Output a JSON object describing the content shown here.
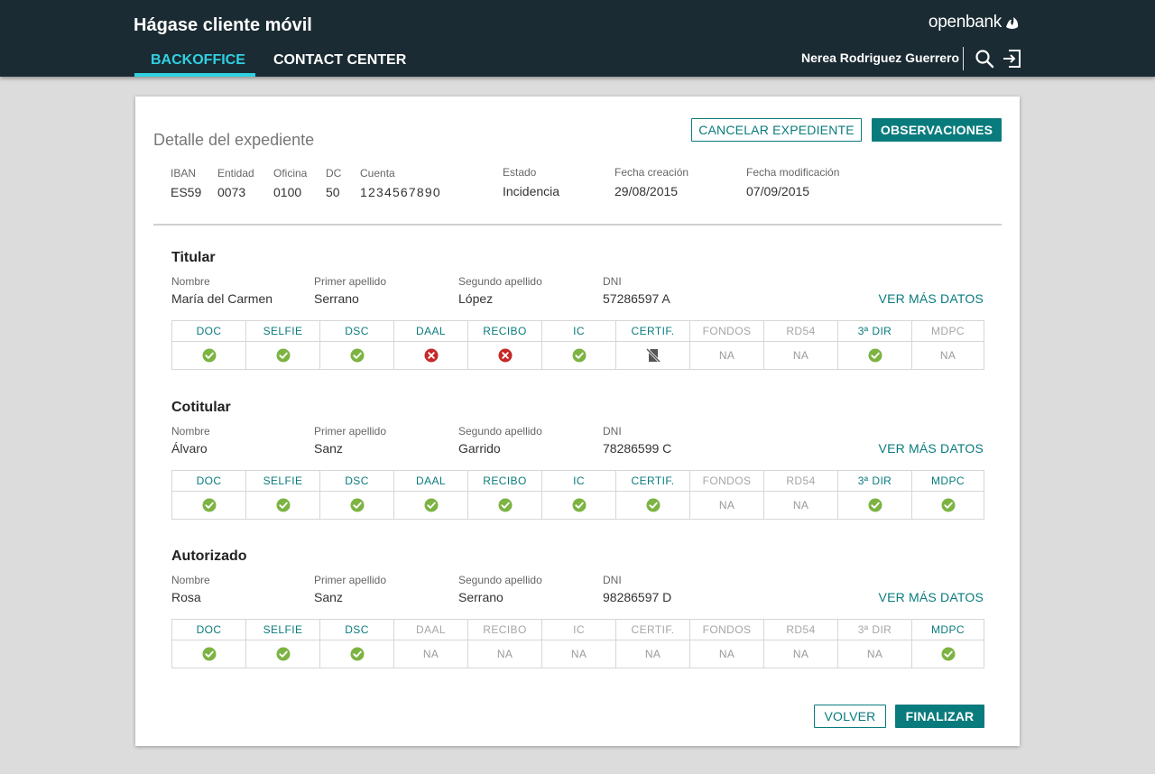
{
  "app": {
    "title": "Hágase cliente móvil",
    "brand": "openbank",
    "tabs": [
      {
        "label": "BACKOFFICE",
        "active": true
      },
      {
        "label": "CONTACT CENTER",
        "active": false
      }
    ],
    "user_name": "Nerea Rodriguez Guerrero"
  },
  "colors": {
    "header_bg": "#1b2b33",
    "accent_cyan": "#2fd0e0",
    "teal": "#0a7b7d",
    "ok_green": "#7cb342",
    "error_red": "#c62828"
  },
  "detail": {
    "title": "Detalle del expediente",
    "cancel_button": "CANCELAR EXPEDIENTE",
    "observations_button": "OBSERVACIONES",
    "account": {
      "labels": {
        "iban": "IBAN",
        "entidad": "Entidad",
        "oficina": "Oficina",
        "dc": "DC",
        "cuenta": "Cuenta",
        "estado": "Estado",
        "fecha_creacion": "Fecha creación",
        "fecha_modificacion": "Fecha modificación"
      },
      "values": {
        "iban": "ES59",
        "entidad": "0073",
        "oficina": "0100",
        "dc": "50",
        "cuenta": "1234567890",
        "estado": "Incidencia",
        "fecha_creacion": "29/08/2015",
        "fecha_modificacion": "07/09/2015"
      }
    }
  },
  "field_labels": {
    "nombre": "Nombre",
    "primer_apellido": "Primer apellido",
    "segundo_apellido": "Segundo apellido",
    "dni": "DNI"
  },
  "ver_mas": "VER MÁS DATOS",
  "columns": [
    "DOC",
    "SELFIE",
    "DSC",
    "DAAL",
    "RECIBO",
    "IC",
    "CERTIF.",
    "FONDOS",
    "RD54",
    "3ª DIR",
    "MDPC"
  ],
  "sections": [
    {
      "title": "Titular",
      "nombre": "María del Carmen",
      "primer_apellido": "Serrano",
      "segundo_apellido": "López",
      "dni": "57286597 A",
      "header_active": [
        true,
        true,
        true,
        true,
        true,
        true,
        true,
        false,
        false,
        true,
        false
      ],
      "status": [
        "ok",
        "ok",
        "ok",
        "error",
        "error",
        "ok",
        "no-doc",
        "NA",
        "NA",
        "ok",
        "NA"
      ]
    },
    {
      "title": "Cotitular",
      "nombre": "Álvaro",
      "primer_apellido": "Sanz",
      "segundo_apellido": "Garrido",
      "dni": "78286599 C",
      "header_active": [
        true,
        true,
        true,
        true,
        true,
        true,
        true,
        false,
        false,
        true,
        true
      ],
      "status": [
        "ok",
        "ok",
        "ok",
        "ok",
        "ok",
        "ok",
        "ok",
        "NA",
        "NA",
        "ok",
        "ok"
      ]
    },
    {
      "title": "Autorizado",
      "nombre": "Rosa",
      "primer_apellido": "Sanz",
      "segundo_apellido": "Serrano",
      "dni": "98286597 D",
      "header_active": [
        true,
        true,
        true,
        false,
        false,
        false,
        false,
        false,
        false,
        false,
        true
      ],
      "status": [
        "ok",
        "ok",
        "ok",
        "NA",
        "NA",
        "NA",
        "NA",
        "NA",
        "NA",
        "NA",
        "ok"
      ]
    }
  ],
  "footer": {
    "back_button": "VOLVER",
    "finish_button": "FINALIZAR"
  }
}
